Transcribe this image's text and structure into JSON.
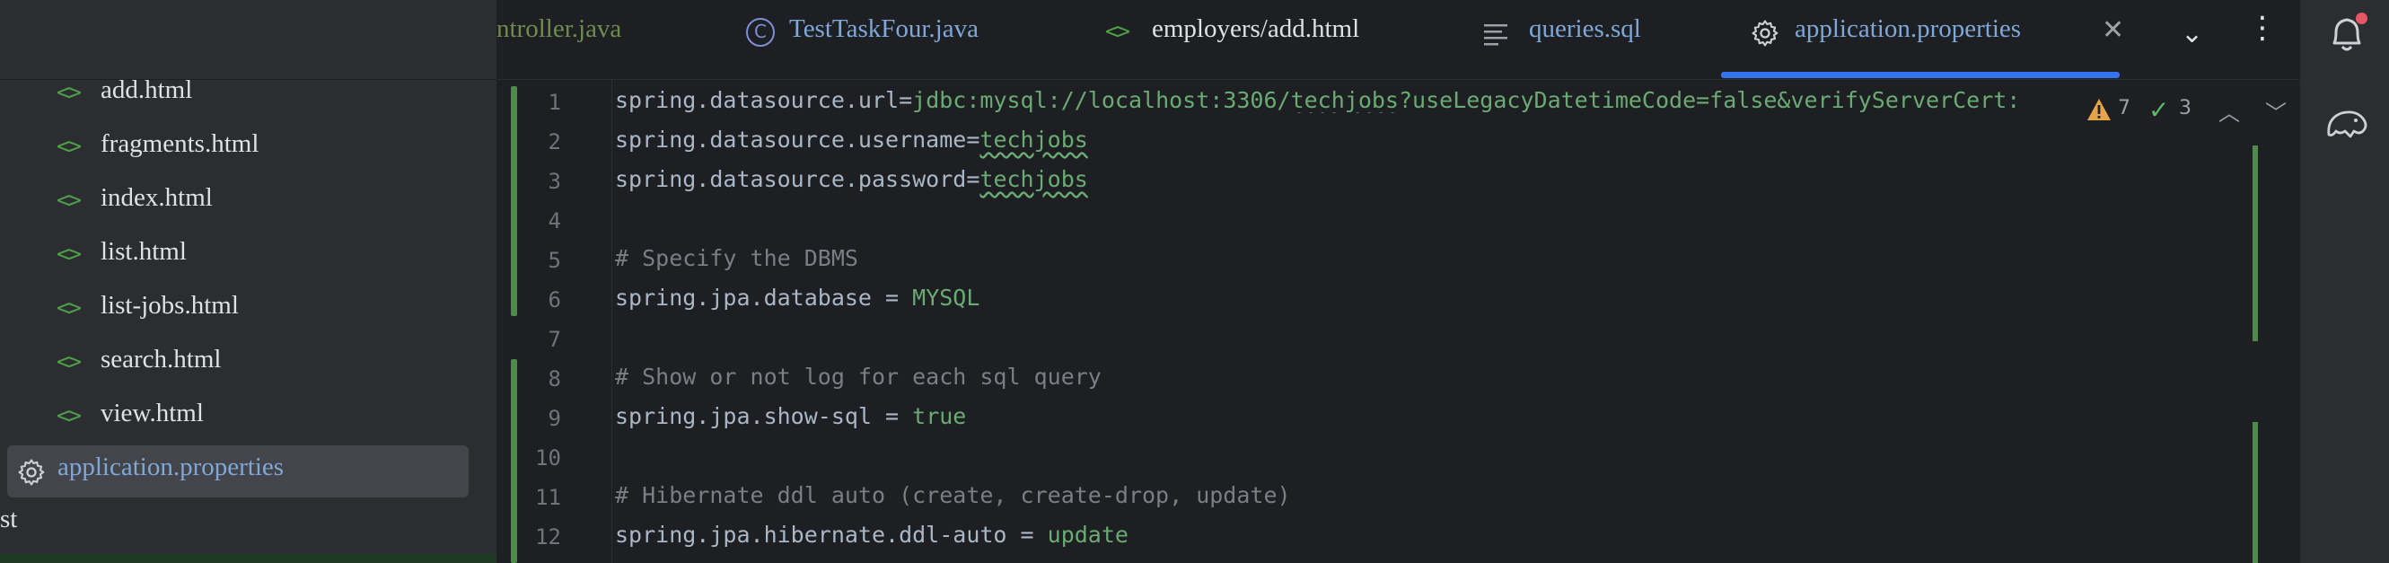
{
  "sidebar": {
    "items": [
      {
        "label": "add.html",
        "icon": "html-file-icon"
      },
      {
        "label": "fragments.html",
        "icon": "html-file-icon"
      },
      {
        "label": "index.html",
        "icon": "html-file-icon"
      },
      {
        "label": "list.html",
        "icon": "html-file-icon"
      },
      {
        "label": "list-jobs.html",
        "icon": "html-file-icon"
      },
      {
        "label": "search.html",
        "icon": "html-file-icon"
      },
      {
        "label": "view.html",
        "icon": "html-file-icon"
      }
    ],
    "selected": {
      "label": "application.properties",
      "icon": "gear-icon"
    },
    "cut_item": "st"
  },
  "tabs": {
    "controller": "ntroller.java",
    "testtask": "TestTaskFour.java",
    "employers": "employers/add.html",
    "queries": "queries.sql",
    "app": "application.properties",
    "html_glyph": "<>"
  },
  "editor": {
    "lines": [
      {
        "n": "1",
        "key": "spring.datasource.url=",
        "val": "jdbc:mysql://localhost:3306/",
        "typo": "techjobs",
        "rest": "?useLegacyDatetimeCode=false&verifyServerCert:"
      },
      {
        "n": "2",
        "key": "spring.datasource.username=",
        "typo": "techjobs"
      },
      {
        "n": "3",
        "key": "spring.datasource.password=",
        "typo": "techjobs"
      },
      {
        "n": "4"
      },
      {
        "n": "5",
        "comment": "# Specify the DBMS"
      },
      {
        "n": "6",
        "key": "spring.jpa.database = ",
        "val": "MYSQL"
      },
      {
        "n": "7"
      },
      {
        "n": "8",
        "comment": "# Show or not log for each sql query"
      },
      {
        "n": "9",
        "key": "spring.jpa.show-sql = ",
        "val": "true"
      },
      {
        "n": "10"
      },
      {
        "n": "11",
        "comment": "# Hibernate ddl auto (create, create-drop, update)"
      },
      {
        "n": "12",
        "key": "spring.jpa.hibernate.ddl-auto = ",
        "val": "update"
      }
    ],
    "inspection": {
      "warnings": "7",
      "ok": "3"
    }
  },
  "colors": {
    "accent": "#3574f0",
    "string_green": "#6aab73",
    "comment_gray": "#7a7e85",
    "vcs_added": "#4e8a4a",
    "notification_dot": "#e55765"
  }
}
